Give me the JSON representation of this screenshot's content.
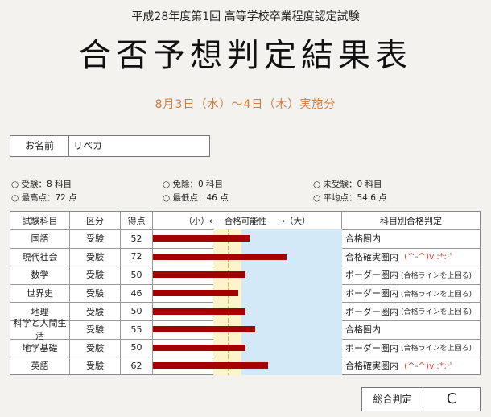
{
  "header": {
    "subtitle": "平成28年度第1回 高等学校卒業程度認定試験",
    "title": "合否予想判定結果表",
    "dates": "8月3日（水）～4日（木）実施分",
    "date_color": "#d07b3c"
  },
  "name": {
    "label": "お名前",
    "value": "リベカ"
  },
  "stats": {
    "taken": "○ 受験：8 科目",
    "exempt": "○ 免除：0 科目",
    "untaken": "○ 未受験：0 科目",
    "max": "○ 最高点：72 点",
    "min": "○ 最低点：46 点",
    "avg": "○ 平均点：54.6 点"
  },
  "table": {
    "headers": {
      "subject": "試験科目",
      "category": "区分",
      "score": "得点",
      "axis_low": "（小）←",
      "axis_mid": "合格可能性",
      "axis_high": "→（大）",
      "verdict": "科目別合格判定"
    },
    "rows": [
      {
        "subject": "国語",
        "category": "受験",
        "score": 52,
        "verdict": "合格圏内",
        "note": "",
        "smiley": ""
      },
      {
        "subject": "現代社会",
        "category": "受験",
        "score": 72,
        "verdict": "合格確実圏内",
        "note": "",
        "smiley": "(^-^)v.:*:·'"
      },
      {
        "subject": "数学",
        "category": "受験",
        "score": 50,
        "verdict": "ボーダー圏内",
        "note": "(合格ラインを上回る)",
        "smiley": ""
      },
      {
        "subject": "世界史",
        "category": "受験",
        "score": 46,
        "verdict": "ボーダー圏内",
        "note": "(合格ラインを上回る)",
        "smiley": ""
      },
      {
        "subject": "地理",
        "category": "受験",
        "score": 50,
        "verdict": "ボーダー圏内",
        "note": "(合格ラインを上回る)",
        "smiley": ""
      },
      {
        "subject": "科学と人間生活",
        "category": "受験",
        "score": 55,
        "verdict": "合格圏内",
        "note": "",
        "smiley": ""
      },
      {
        "subject": "地学基礎",
        "category": "受験",
        "score": 50,
        "verdict": "ボーダー圏内",
        "note": "(合格ラインを上回る)",
        "smiley": ""
      },
      {
        "subject": "英語",
        "category": "受験",
        "score": 62,
        "verdict": "合格確実圏内",
        "note": "",
        "smiley": "(^-^)v.:*:·'"
      }
    ]
  },
  "total": {
    "label": "総合判定",
    "value": "C"
  },
  "colors": {
    "bar": "#a50000",
    "border_zone": "#fdf4c9",
    "pass_zone": "#d3e9f7"
  }
}
